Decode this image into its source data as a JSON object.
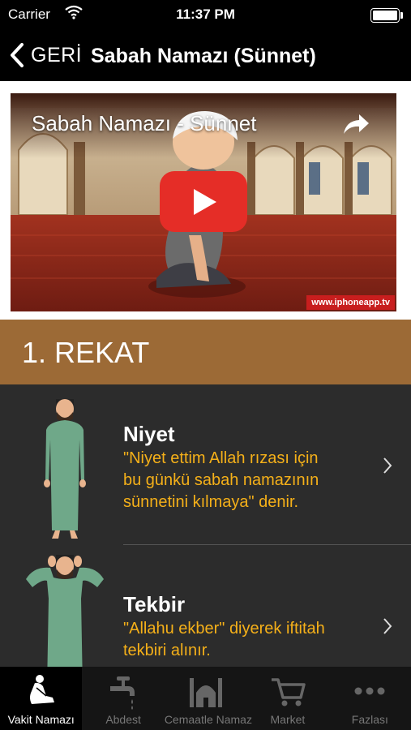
{
  "status_bar": {
    "carrier": "Carrier",
    "time": "11:37 PM"
  },
  "nav": {
    "back_label": "GERİ",
    "title": "Sabah Namazı (Sünnet)"
  },
  "video": {
    "title": "Sabah Namazı - Sünnet",
    "watermark": "www.iphoneapp.tv"
  },
  "section": {
    "title": "1. REKAT"
  },
  "steps": [
    {
      "name": "Niyet",
      "lines": [
        "\"Niyet ettim Allah rızası için",
        "bu günkü sabah namazının",
        "sünnetini kılmaya\" denir."
      ]
    },
    {
      "name": "Tekbir",
      "lines": [
        "\"Allahu ekber\" diyerek iftitah",
        "tekbiri alınır."
      ]
    }
  ],
  "tabs": [
    {
      "label": "Vakit Namazı",
      "icon": "prayer-icon",
      "active": true
    },
    {
      "label": "Abdest",
      "icon": "faucet-icon",
      "active": false
    },
    {
      "label": "Cemaatle Namaz",
      "icon": "mosque-icon",
      "active": false
    },
    {
      "label": "Market",
      "icon": "cart-icon",
      "active": false
    },
    {
      "label": "Fazlası",
      "icon": "more-icon",
      "active": false
    }
  ],
  "colors": {
    "section_header": "#9c6a36",
    "description_text": "#f5b019",
    "play_button": "#e52d27",
    "robe": "#6fa889"
  }
}
